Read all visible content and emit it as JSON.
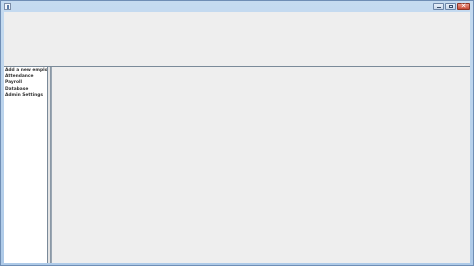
{
  "window": {
    "close_glyph": "✕"
  },
  "sidebar": {
    "items": [
      {
        "label": "Add a new employee"
      },
      {
        "label": "Attendance"
      },
      {
        "label": "Payroll"
      },
      {
        "label": "Database"
      },
      {
        "label": "Admin Settings"
      }
    ]
  }
}
